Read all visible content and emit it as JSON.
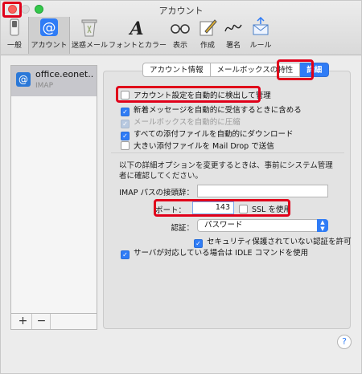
{
  "window": {
    "title": "アカウント"
  },
  "toolbar": [
    {
      "label": "一般",
      "icon": "switch-icon"
    },
    {
      "label": "アカウント",
      "icon": "at-icon"
    },
    {
      "label": "迷惑メール",
      "icon": "trash-icon"
    },
    {
      "label": "フォントとカラー",
      "icon": "font-icon"
    },
    {
      "label": "表示",
      "icon": "glasses-icon"
    },
    {
      "label": "作成",
      "icon": "compose-icon"
    },
    {
      "label": "署名",
      "icon": "signature-icon"
    },
    {
      "label": "ルール",
      "icon": "rules-icon"
    }
  ],
  "sidebar": {
    "account_name": "office.eonet..",
    "account_type": "IMAP",
    "add_label": "+",
    "remove_label": "−"
  },
  "tabs": [
    {
      "label": "アカウント情報",
      "selected": false
    },
    {
      "label": "メールボックスの特性",
      "selected": false
    },
    {
      "label": "詳細",
      "selected": true
    }
  ],
  "options": [
    {
      "label": "アカウント設定を自動的に検出して管理",
      "checked": false,
      "enabled": true
    },
    {
      "label": "新着メッセージを自動的に受信するときに含める",
      "checked": true,
      "enabled": true
    },
    {
      "label": "メールボックスを自動的に圧縮",
      "checked": true,
      "enabled": false
    },
    {
      "label": "すべての添付ファイルを自動的にダウンロード",
      "checked": true,
      "enabled": true
    },
    {
      "label": "大きい添付ファイルを Mail Drop で送信",
      "checked": false,
      "enabled": true
    }
  ],
  "advanced_note": "以下の詳細オプションを変更するときは、事前にシステム管理者に確認してください。",
  "imap_prefix": {
    "label": "IMAP パスの接頭辞：",
    "value": ""
  },
  "port": {
    "label": "ポート：",
    "value": "143"
  },
  "ssl": {
    "label": "SSL を使用",
    "checked": false
  },
  "auth": {
    "label": "認証：",
    "value": "パスワード"
  },
  "allow_insecure": {
    "label": "セキュリティ保護されていない認証を許可",
    "checked": true
  },
  "idle": {
    "label": "サーバが対応している場合は IDLE コマンドを使用",
    "checked": true
  },
  "help": {
    "label": "?"
  },
  "colors": {
    "accent": "#2f7cf6",
    "highlight": "#e0001a"
  }
}
